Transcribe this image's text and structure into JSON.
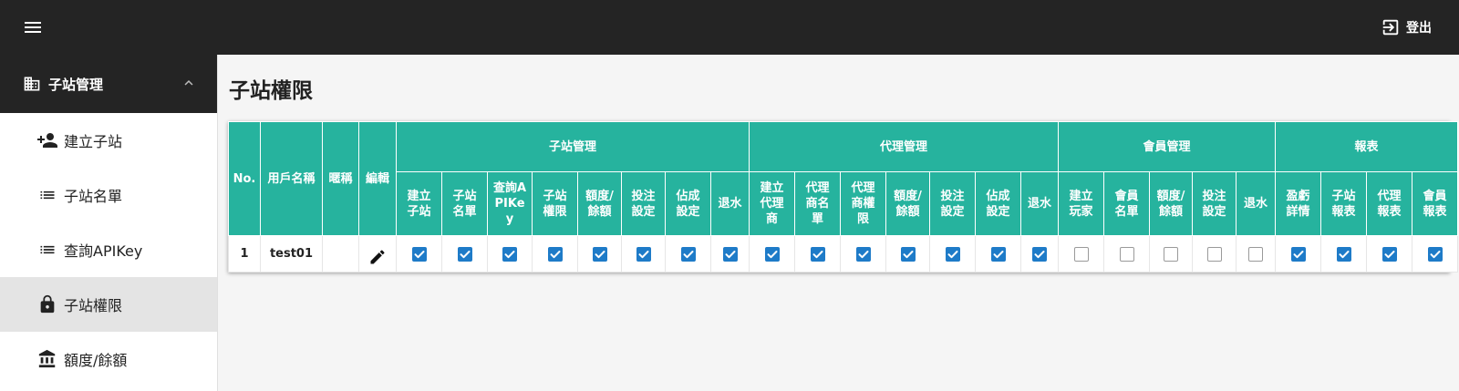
{
  "topbar": {
    "menu_icon": "hamburger-icon",
    "logout_icon": "exit-icon",
    "logout_label": "登出"
  },
  "sidebar": {
    "group": {
      "icon": "building-icon",
      "label": "子站管理",
      "expanded": true
    },
    "items": [
      {
        "icon": "person-add-icon",
        "label": "建立子站",
        "active": false
      },
      {
        "icon": "list-icon",
        "label": "子站名單",
        "active": false
      },
      {
        "icon": "list-icon",
        "label": "查詢APIKey",
        "active": false
      },
      {
        "icon": "lock-icon",
        "label": "子站權限",
        "active": true
      },
      {
        "icon": "bank-icon",
        "label": "額度/餘額",
        "active": false
      }
    ]
  },
  "page": {
    "title": "子站權限"
  },
  "table": {
    "fixed_headers": [
      "No.",
      "用戶名稱",
      "暱稱",
      "編輯"
    ],
    "groups": [
      {
        "label": "子站管理",
        "columns": [
          "建立\n子站",
          "子站\n名單",
          "查詢A\nPIKe\ny",
          "子站\n權限",
          "額度/\n餘額",
          "投注\n設定",
          "佔成\n設定",
          "退水"
        ]
      },
      {
        "label": "代理管理",
        "columns": [
          "建立\n代理\n商",
          "代理\n商名\n單",
          "代理\n商權\n限",
          "額度/\n餘額",
          "投注\n設定",
          "佔成\n設定",
          "退水"
        ]
      },
      {
        "label": "會員管理",
        "columns": [
          "建立\n玩家",
          "會員\n名單",
          "額度/\n餘額",
          "投注\n設定",
          "退水"
        ]
      },
      {
        "label": "報表",
        "columns": [
          "盈虧\n詳情",
          "子站\n報表",
          "代理\n報表",
          "會員\n報表"
        ]
      }
    ],
    "rows": [
      {
        "no": "1",
        "username": "test01",
        "nickname": "",
        "edit_icon": "pencil-icon",
        "permissions": [
          true,
          true,
          true,
          true,
          true,
          true,
          true,
          true,
          true,
          true,
          true,
          true,
          true,
          true,
          true,
          false,
          false,
          false,
          false,
          false,
          true,
          true,
          true,
          true
        ]
      }
    ]
  },
  "colors": {
    "topbar": "#242424",
    "header": "#26b39e",
    "checkbox": "#1e7bc8",
    "active_item": "#e4e4e4"
  }
}
